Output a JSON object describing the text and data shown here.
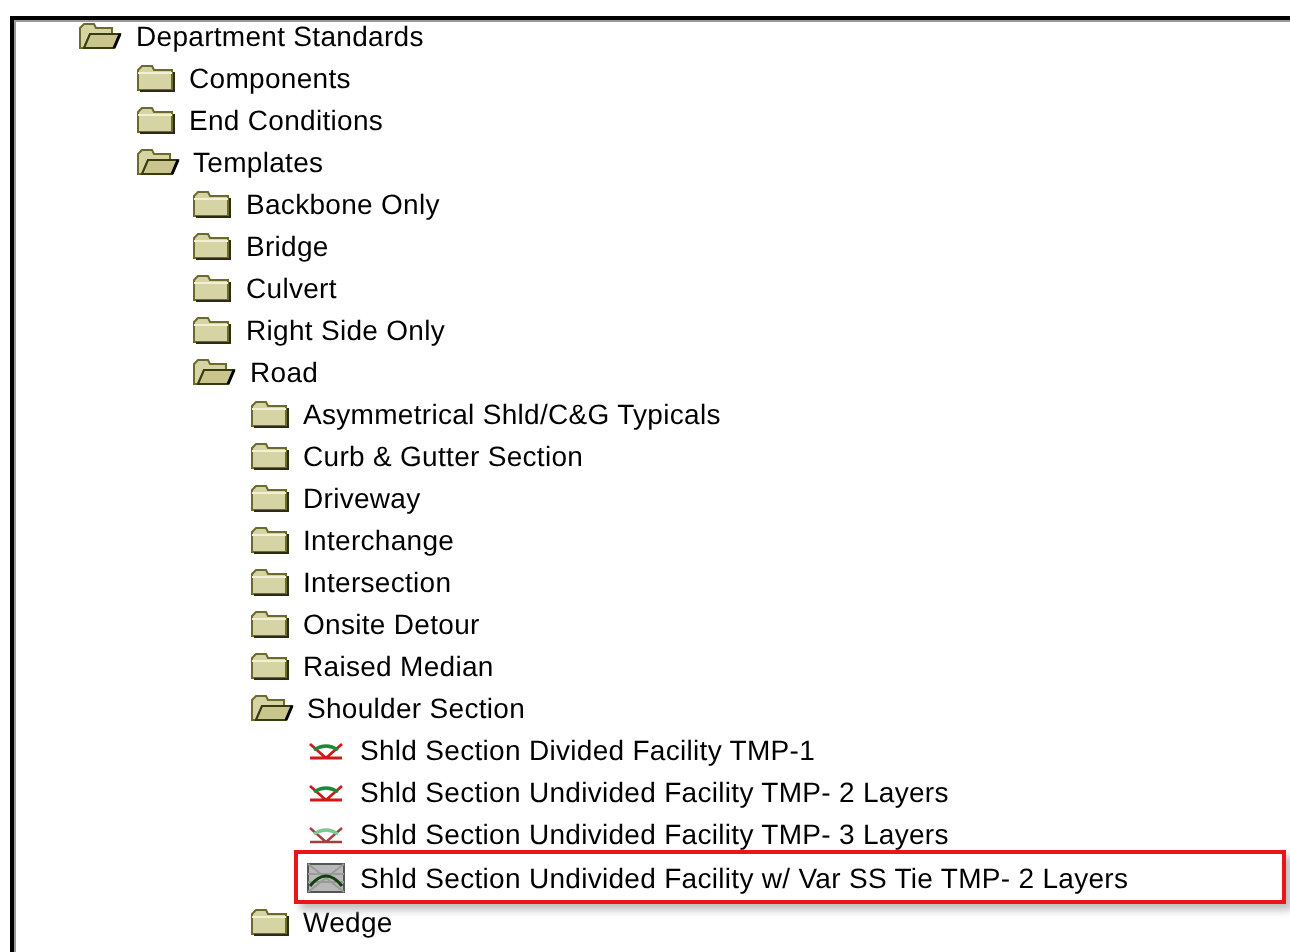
{
  "tree": [
    {
      "label": "Department Standards",
      "kind": "folder",
      "expanded": true,
      "children": [
        {
          "label": "Components",
          "kind": "folder",
          "expanded": false
        },
        {
          "label": "End Conditions",
          "kind": "folder",
          "expanded": false
        },
        {
          "label": "Templates",
          "kind": "folder",
          "expanded": true,
          "children": [
            {
              "label": "Backbone Only",
              "kind": "folder",
              "expanded": false
            },
            {
              "label": "Bridge",
              "kind": "folder",
              "expanded": false
            },
            {
              "label": "Culvert",
              "kind": "folder",
              "expanded": false
            },
            {
              "label": "Right Side Only",
              "kind": "folder",
              "expanded": false
            },
            {
              "label": "Road",
              "kind": "folder",
              "expanded": true,
              "children": [
                {
                  "label": "Asymmetrical Shld/C&G Typicals",
                  "kind": "folder",
                  "expanded": false
                },
                {
                  "label": "Curb & Gutter Section",
                  "kind": "folder",
                  "expanded": false
                },
                {
                  "label": "Driveway",
                  "kind": "folder",
                  "expanded": false
                },
                {
                  "label": "Interchange",
                  "kind": "folder",
                  "expanded": false
                },
                {
                  "label": "Intersection",
                  "kind": "folder",
                  "expanded": false
                },
                {
                  "label": "Onsite Detour",
                  "kind": "folder",
                  "expanded": false
                },
                {
                  "label": "Raised Median",
                  "kind": "folder",
                  "expanded": false
                },
                {
                  "label": "Shoulder Section",
                  "kind": "folder",
                  "expanded": true,
                  "children": [
                    {
                      "label": "Shld Section Divided Facility TMP-1",
                      "kind": "template",
                      "highlighted": false
                    },
                    {
                      "label": "Shld Section Undivided Facility TMP- 2 Layers",
                      "kind": "template",
                      "highlighted": false
                    },
                    {
                      "label": "Shld Section Undivided Facility TMP- 3 Layers",
                      "kind": "template-dim",
                      "highlighted": false
                    },
                    {
                      "label": "Shld Section Undivided Facility w/ Var SS Tie TMP- 2 Layers",
                      "kind": "template-shaded",
                      "highlighted": true
                    }
                  ]
                },
                {
                  "label": "Wedge",
                  "kind": "folder",
                  "expanded": false
                }
              ]
            }
          ]
        }
      ]
    }
  ]
}
